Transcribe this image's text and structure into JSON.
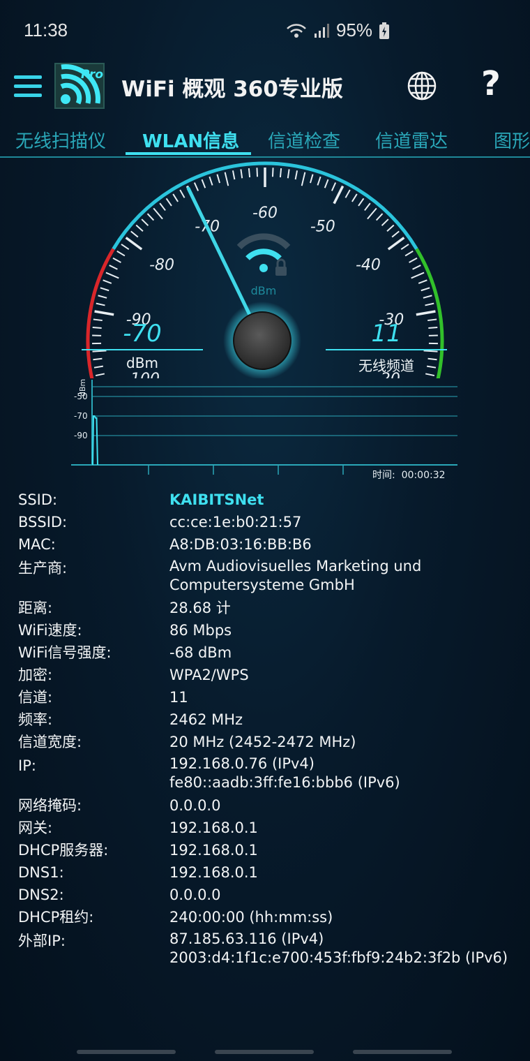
{
  "status": {
    "time": "11:38",
    "battery": "95%"
  },
  "app": {
    "title": "WiFi 概观 360专业版",
    "logo_badge": "Pro"
  },
  "tabs": [
    {
      "label": "无线扫描仪",
      "active": false
    },
    {
      "label": "WLAN信息",
      "active": true
    },
    {
      "label": "信道检查",
      "active": false
    },
    {
      "label": "信道雷达",
      "active": false
    },
    {
      "label": "图形",
      "active": false
    }
  ],
  "gauge": {
    "ticks": [
      "-100",
      "-90",
      "-80",
      "-70",
      "-60",
      "-50",
      "-40",
      "-30",
      "-20"
    ],
    "unit": "dBm",
    "needle_value": -70,
    "min": -100,
    "max": -20,
    "colors": {
      "low": "#d9262a",
      "mid": "#2bc4dc",
      "high": "#32c02a"
    },
    "signal_value": "-70",
    "signal_label": "dBm",
    "channel_value": "11",
    "channel_label": "无线频道"
  },
  "graph": {
    "y_unit": "dBm",
    "y_ticks": [
      "-50",
      "-70",
      "-90"
    ],
    "time_label": "时间:",
    "time_value": "00:00:32",
    "samples": [
      -70,
      -70,
      -72,
      -72
    ]
  },
  "info": [
    {
      "label": "SSID:",
      "value": [
        "KAIBITSNet"
      ],
      "accent": true
    },
    {
      "label": "BSSID:",
      "value": [
        "cc:ce:1e:b0:21:57"
      ]
    },
    {
      "label": "MAC:",
      "value": [
        "A8:DB:03:16:BB:B6"
      ]
    },
    {
      "label": "生产商:",
      "value": [
        "Avm Audiovisuelles Marketing und",
        "Computersysteme GmbH"
      ]
    },
    {
      "label": "距离:",
      "value": [
        "28.68 计"
      ]
    },
    {
      "label": "WiFi速度:",
      "value": [
        "86 Mbps"
      ]
    },
    {
      "label": "WiFi信号强度:",
      "value": [
        "-68 dBm"
      ]
    },
    {
      "label": "加密:",
      "value": [
        "WPA2/WPS"
      ]
    },
    {
      "label": "信道:",
      "value": [
        "11"
      ]
    },
    {
      "label": "频率:",
      "value": [
        "2462 MHz"
      ]
    },
    {
      "label": "信道宽度:",
      "value": [
        "20 MHz (2452-2472 MHz)"
      ]
    },
    {
      "label": "IP:",
      "value": [
        "192.168.0.76 (IPv4)",
        "fe80::aadb:3ff:fe16:bbb6 (IPv6)"
      ]
    },
    {
      "label": "网络掩码:",
      "value": [
        "0.0.0.0"
      ]
    },
    {
      "label": "网关:",
      "value": [
        "192.168.0.1"
      ]
    },
    {
      "label": "DHCP服务器:",
      "value": [
        "192.168.0.1"
      ]
    },
    {
      "label": "DNS1:",
      "value": [
        "192.168.0.1"
      ]
    },
    {
      "label": "DNS2:",
      "value": [
        "0.0.0.0"
      ]
    },
    {
      "label": "DHCP租约:",
      "value": [
        "240:00:00 (hh:mm:ss)"
      ]
    },
    {
      "label": "外部IP:",
      "value": [
        "87.185.63.116 (IPv4)",
        "2003:d4:1f1c:e700:453f:fbf9:24b2:3f2b (IPv6)"
      ]
    }
  ]
}
